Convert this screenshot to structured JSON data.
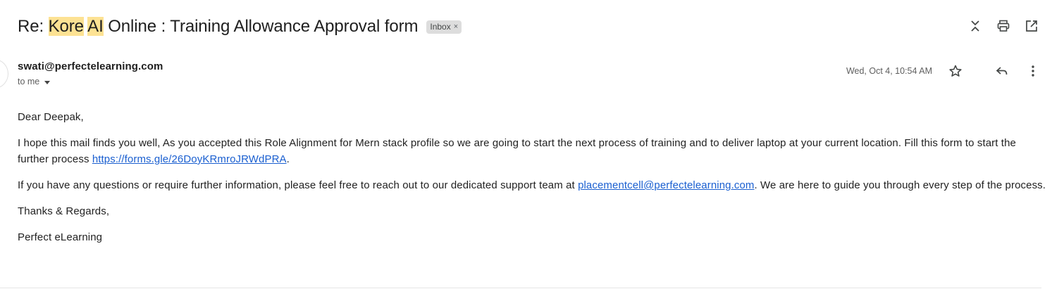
{
  "email": {
    "subject": {
      "prefix": "Re: ",
      "highlight1": "Kore",
      "space": " ",
      "highlight2": "AI",
      "rest": " Online : Training Allowance Approval form"
    },
    "label_badge": "Inbox",
    "label_remove": "×",
    "sender": "swati@perfectelearning.com",
    "to_line": "to me",
    "date": "Wed, Oct 4, 10:54 AM",
    "body": {
      "greeting": "Dear Deepak,",
      "para1_text": "I hope this mail finds you well, As you accepted this Role Alignment for Mern stack profile so we are going to start the next process of training and to deliver laptop at your current location. Fill this form to start the further process ",
      "para1_link": "https://forms.gle/26DoyKRmroJRWdPRA",
      "para1_end": ".",
      "para2_text": "If you have any questions or require further information, please feel free to reach out to our dedicated support team at ",
      "para2_link": "placementcell@perfectelearning.com",
      "para2_end": ". We are here to guide you through every step of the process.",
      "closing": "Thanks & Regards,",
      "signature": "Perfect eLearning"
    }
  },
  "icons": {
    "collapse": "collapse-all-icon",
    "print": "print-icon",
    "open_new": "open-in-new-window-icon",
    "star": "star-icon",
    "reply": "reply-icon",
    "more": "more-vertical-icon"
  },
  "colors": {
    "highlight": "#fde293",
    "link": "#1a5fd0",
    "badge_bg": "#dddddd"
  }
}
